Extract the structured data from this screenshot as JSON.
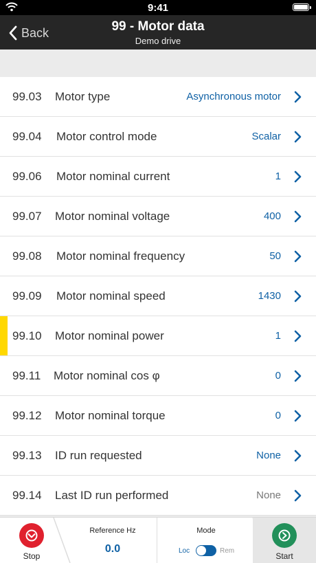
{
  "status_bar": {
    "time": "9:41"
  },
  "nav": {
    "back_label": "Back",
    "title": "99 - Motor data",
    "subtitle": "Demo drive"
  },
  "parameters": [
    {
      "code": "99.03",
      "name": "Motor type",
      "value": "Asynchronous motor"
    },
    {
      "code": "99.04",
      "name": "Motor control mode",
      "value": "Scalar"
    },
    {
      "code": "99.06",
      "name": "Motor nominal current",
      "value": "1"
    },
    {
      "code": "99.07",
      "name": "Motor nominal voltage",
      "value": "400"
    },
    {
      "code": "99.08",
      "name": "Motor nominal frequency",
      "value": "50"
    },
    {
      "code": "99.09",
      "name": "Motor nominal speed",
      "value": "1430"
    },
    {
      "code": "99.10",
      "name": "Motor nominal power",
      "value": "1"
    },
    {
      "code": "99.11",
      "name": "Motor nominal cos φ",
      "value": "0"
    },
    {
      "code": "99.12",
      "name": "Motor nominal torque",
      "value": "0"
    },
    {
      "code": "99.13",
      "name": "ID run requested",
      "value": "None"
    },
    {
      "code": "99.14",
      "name": "Last ID run performed",
      "value": "None"
    }
  ],
  "bottom": {
    "stop_label": "Stop",
    "reference_label": "Reference Hz",
    "reference_value": "0.0",
    "mode_label": "Mode",
    "loc_label": "Loc",
    "rem_label": "Rem",
    "start_label": "Start"
  },
  "colors": {
    "accent": "#0f61a5",
    "stop": "#e0212e",
    "start": "#22905a",
    "highlight": "#ffd800"
  }
}
